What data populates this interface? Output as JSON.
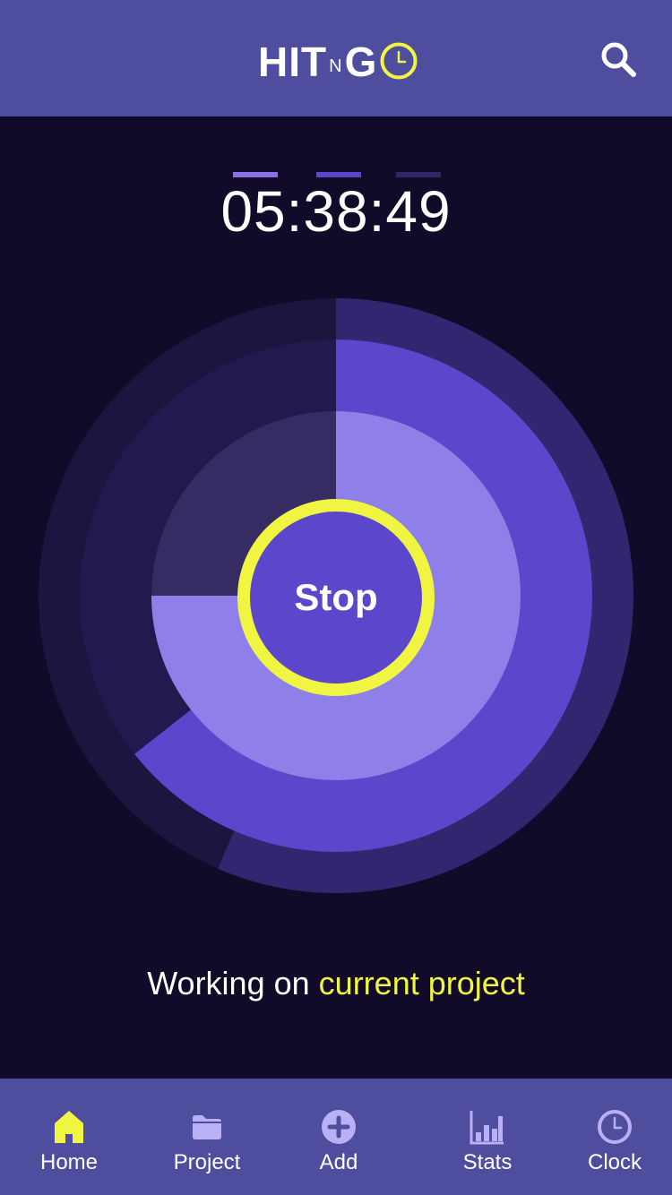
{
  "app": {
    "logo_part1": "HIT",
    "logo_small": "N",
    "logo_part2": "G",
    "brand_accent": "#f0f542",
    "header_bg": "#4e4d9e",
    "background": "#110b29"
  },
  "header": {
    "search_icon": "search-icon"
  },
  "timer": {
    "value": "05:38:49",
    "hours_indicator_color": "#8b72e4",
    "minutes_indicator_color": "#5b46cc",
    "seconds_indicator_color": "#2f2668"
  },
  "dial": {
    "outer_ring_progress": 0.565,
    "middle_ring_progress": 0.644,
    "inner_ring_progress": 0.75,
    "outer_fill": "#322670",
    "outer_track": "#1b1540",
    "middle_fill": "#5b46cc",
    "middle_track": "#22194e",
    "inner_fill": "#8f7fe8",
    "inner_track": "#372b64",
    "stop_label": "Stop"
  },
  "status": {
    "prefix": "Working on",
    "project": "current project"
  },
  "tabs": [
    {
      "label": "Home",
      "icon": "home-icon",
      "active": true
    },
    {
      "label": "Project",
      "icon": "folder-icon",
      "active": false
    },
    {
      "label": "Add",
      "icon": "plus-circle-icon",
      "active": false
    },
    {
      "label": "Stats",
      "icon": "bar-chart-icon",
      "active": false
    },
    {
      "label": "Clock",
      "icon": "clock-icon",
      "active": false
    }
  ]
}
